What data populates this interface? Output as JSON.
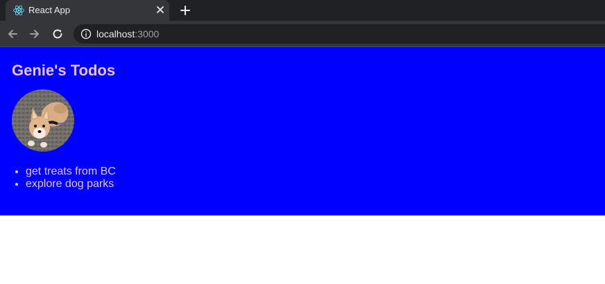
{
  "browser": {
    "tab_title": "React App",
    "url_host": "localhost",
    "url_port": ":3000"
  },
  "page": {
    "title": "Genie's Todos",
    "background_color": "#0000ff",
    "text_color": "#e6c2f0",
    "todos": [
      "get treats from BC",
      "explore dog parks"
    ]
  },
  "icons": {
    "favicon": "react-logo-icon",
    "tab_close": "close-icon",
    "new_tab": "plus-icon",
    "back": "arrow-left-icon",
    "forward": "arrow-right-icon",
    "reload": "reload-icon",
    "site_info": "info-icon",
    "avatar": "dog-photo"
  }
}
